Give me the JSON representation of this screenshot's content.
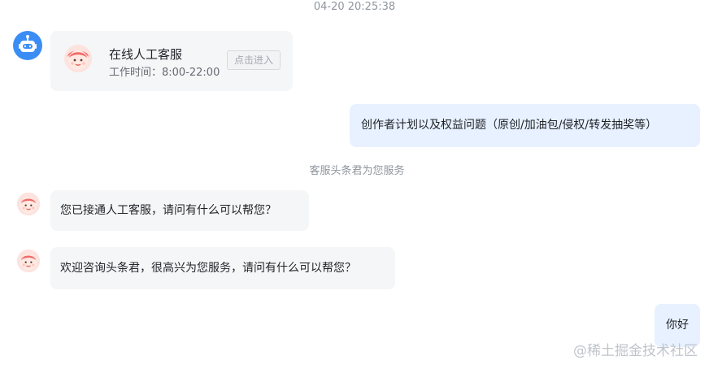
{
  "header": {
    "timestamp": "04-20 20:25:38"
  },
  "bot": {
    "avatar_icon": "robot-icon"
  },
  "agent_card": {
    "avatar_icon": "agent-face-icon",
    "name": "在线人工客服",
    "hours": "工作时间：8:00-22:00",
    "enter_button_label": "点击进入"
  },
  "messages": [
    {
      "direction": "outgoing",
      "text": "创作者计划以及权益问题（原创/加油包/侵权/转发抽奖等）"
    },
    {
      "direction": "incoming",
      "text": "您已接通人工客服，请问有什么可以帮您？"
    },
    {
      "direction": "incoming",
      "text": "欢迎咨询头条君，很高兴为您服务，请问有什么可以帮您？"
    },
    {
      "direction": "outgoing",
      "text": "你好"
    }
  ],
  "system_note": "客服头条君为您服务",
  "watermark": "@稀土掘金技术社区",
  "colors": {
    "bot_blue": "#3b8df6",
    "outgoing_bubble": "#e8f1ff",
    "incoming_bubble": "#f5f6f7",
    "agent_face": "#f87171"
  }
}
